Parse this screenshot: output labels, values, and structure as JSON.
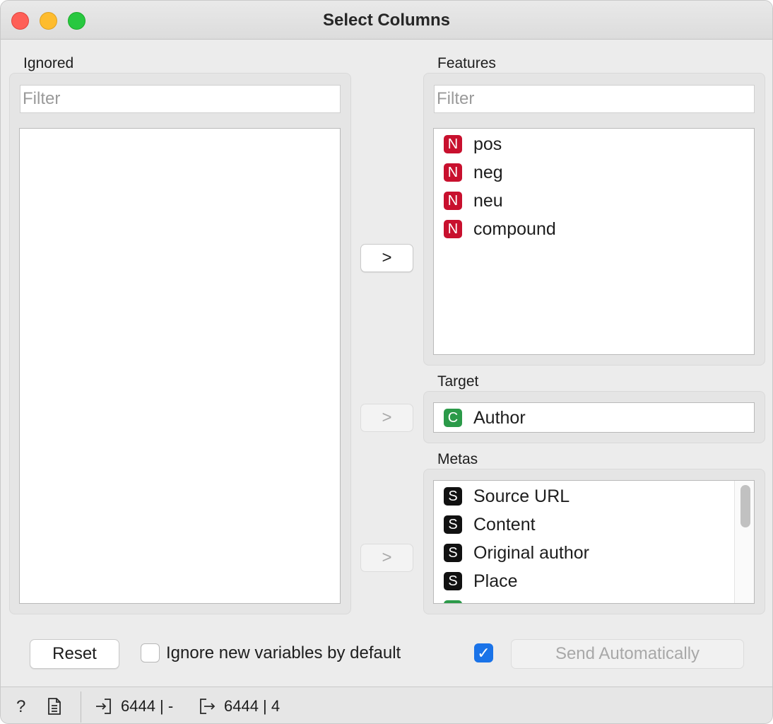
{
  "window": {
    "title": "Select Columns"
  },
  "ignored": {
    "label": "Ignored",
    "filter_placeholder": "Filter",
    "items": []
  },
  "features": {
    "label": "Features",
    "filter_placeholder": "Filter",
    "items": [
      {
        "type": "N",
        "name": "pos"
      },
      {
        "type": "N",
        "name": "neg"
      },
      {
        "type": "N",
        "name": "neu"
      },
      {
        "type": "N",
        "name": "compound"
      }
    ]
  },
  "target": {
    "label": "Target",
    "items": [
      {
        "type": "C",
        "name": "Author"
      }
    ]
  },
  "metas": {
    "label": "Metas",
    "items": [
      {
        "type": "S",
        "name": "Source URL"
      },
      {
        "type": "S",
        "name": "Content"
      },
      {
        "type": "S",
        "name": "Original author"
      },
      {
        "type": "S",
        "name": "Place"
      }
    ]
  },
  "move_buttons": {
    "features": ">",
    "target": ">",
    "metas": ">"
  },
  "controls": {
    "reset_label": "Reset",
    "ignore_new_label": "Ignore new variables by default",
    "ignore_new_checked": false,
    "auto_send_checked": true,
    "send_label": "Send Automatically"
  },
  "status": {
    "input_summary": "6444 | -",
    "output_summary": "6444 | 4"
  },
  "colors": {
    "numeric_badge": "#c8102e",
    "categorical_badge": "#2b9a49",
    "string_badge": "#111111",
    "checkbox_checked": "#1a73e8"
  }
}
